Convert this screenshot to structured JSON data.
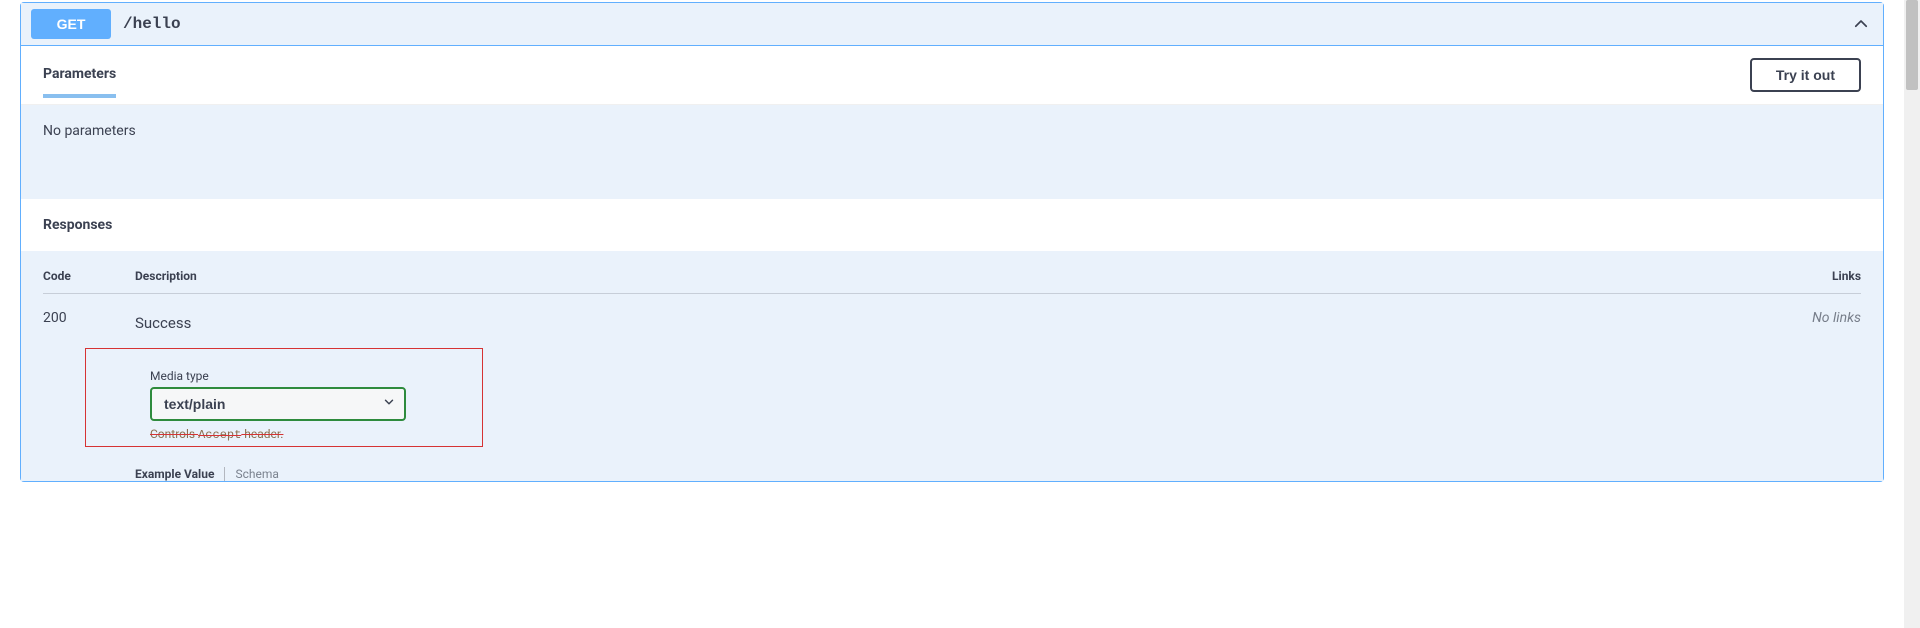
{
  "op": {
    "method": "GET",
    "path": "/hello"
  },
  "parameters": {
    "tab_label": "Parameters",
    "try_label": "Try it out",
    "empty_text": "No parameters"
  },
  "responses": {
    "heading": "Responses",
    "columns": {
      "code": "Code",
      "description": "Description",
      "links": "Links"
    },
    "items": [
      {
        "code": "200",
        "description": "Success",
        "links_text": "No links",
        "media": {
          "label": "Media type",
          "selected": "text/plain",
          "note_prefix": "Controls ",
          "note_code": "Accept",
          "note_suffix": " header."
        },
        "example_tabs": {
          "active": "Example Value",
          "inactive": "Schema"
        }
      }
    ]
  }
}
